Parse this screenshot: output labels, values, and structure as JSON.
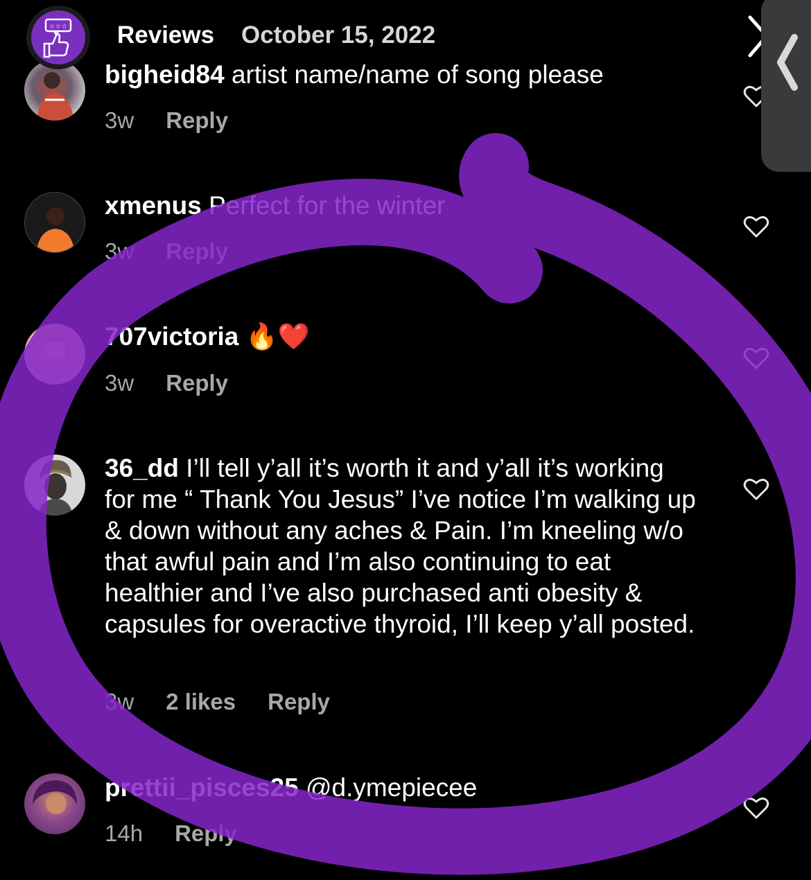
{
  "header": {
    "title": "Reviews",
    "date": "October 15, 2022",
    "logo_icon": "thumbs-up-review-icon",
    "back_icon": "chevron-left-icon",
    "next_icon": "chevron-right-icon"
  },
  "colors": {
    "background": "#000000",
    "accent_purple": "#8a2be2",
    "meta_gray": "#a8a8a8",
    "panel_gray": "#3a3a3a"
  },
  "comments": [
    {
      "username": "bigheid84",
      "text": "artist name/name of song please",
      "time": "3w",
      "reply": "Reply"
    },
    {
      "username": "xmenus",
      "text": "Perfect for the winter",
      "time": "3w",
      "reply": "Reply"
    },
    {
      "username": "707victoria",
      "text": "🔥❤️",
      "time": "3w",
      "reply": "Reply"
    },
    {
      "username": "36_dd",
      "text": "I’ll tell y’all it’s worth it and y’all it’s working for me “ Thank You Jesus” I’ve notice I’m walking up & down without any aches & Pain. I’m kneeling w/o that awful pain and I’m also continuing to eat healthier and I’ve also purchased anti obesity & capsules for overactive thyroid, I’ll keep y’all posted.",
      "time": "3w",
      "likes": "2 likes",
      "reply": "Reply"
    },
    {
      "username": "prettii_pisces25",
      "text": "@d.ymepiecee",
      "time": "14h",
      "reply": "Reply"
    }
  ]
}
